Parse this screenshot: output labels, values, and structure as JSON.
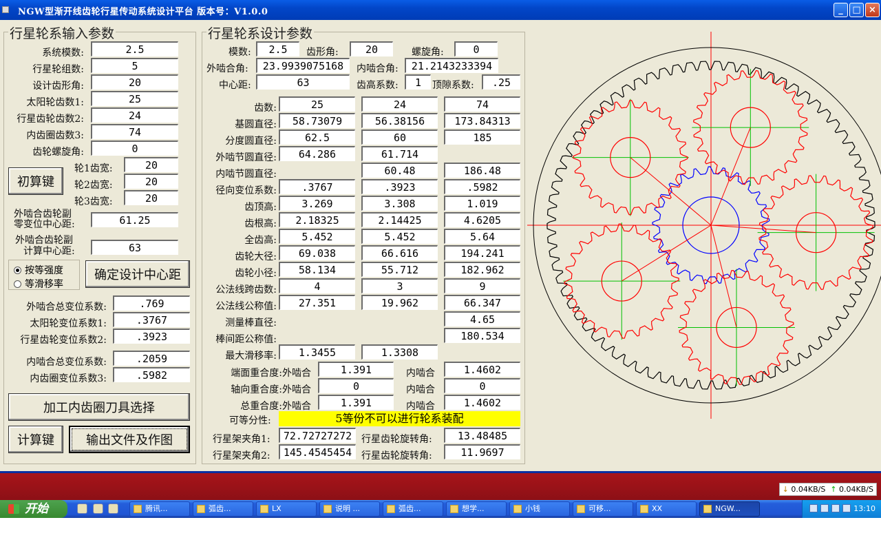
{
  "window": {
    "title": "NGW型渐开线齿轮行星传动系统设计平台   版本号：V1.0.0",
    "minimize": "_",
    "maximize": "□",
    "close": "×"
  },
  "input_panel": {
    "title": "行星轮系输入参数",
    "fields": [
      {
        "label": "系统模数:",
        "value": "2.5"
      },
      {
        "label": "行星轮组数:",
        "value": "5"
      },
      {
        "label": "设计齿形角:",
        "value": "20"
      },
      {
        "label": "太阳轮齿数1:",
        "value": "25"
      },
      {
        "label": "行星齿轮齿数2:",
        "value": "24"
      },
      {
        "label": "内齿圈齿数3:",
        "value": "74"
      },
      {
        "label": "齿轮螺旋角:",
        "value": "0"
      }
    ],
    "init_button": "初算键",
    "widths": [
      {
        "label": "轮1齿宽:",
        "value": "20"
      },
      {
        "label": "轮2齿宽:",
        "value": "20"
      },
      {
        "label": "轮3齿宽:",
        "value": "20"
      }
    ],
    "ext_zero_label1": "外啮合齿轮副",
    "ext_zero_label2": "零变位中心距:",
    "ext_zero_value": "61.25",
    "ext_calc_label1": "外啮合齿轮副",
    "ext_calc_label2": "计算中心距:",
    "ext_calc_value": "63",
    "radio_strength": "按等强度",
    "radio_slip": "等滑移率",
    "confirm_button": "确定设计中心距",
    "shift_fields": [
      {
        "label": "外啮合总变位系数:",
        "value": ".769"
      },
      {
        "label": "太阳轮变位系数1:",
        "value": ".3767"
      },
      {
        "label": "行星齿轮变位系数2:",
        "value": ".3923"
      },
      {
        "label": "内啮合总变位系数:",
        "value": ".2059"
      },
      {
        "label": "内齿圈变位系数3:",
        "value": ".5982"
      }
    ],
    "tool_button": "加工内齿圈刀具选择",
    "calc_button": "计算键",
    "output_button": "输出文件及作图"
  },
  "design_panel": {
    "title": "行星轮系设计参数",
    "module_label": "模数:",
    "module": "2.5",
    "pressure_label": "齿形角:",
    "pressure": "20",
    "helix_label": "螺旋角:",
    "helix": "0",
    "ext_angle_label": "外啮合角:",
    "ext_angle": "23.9939075168",
    "int_angle_label": "内啮合角:",
    "int_angle": "21.2143233394",
    "center_label": "中心距:",
    "center": "63",
    "addendum_coef_label": "齿高系数:",
    "addendum_coef": "1",
    "clearance_label": "顶隙系数:",
    "clearance": ".25",
    "rows": [
      {
        "label": "齿数:",
        "v1": "25",
        "v2": "24",
        "v3": "74"
      },
      {
        "label": "基圆直径:",
        "v1": "58.73079",
        "v2": "56.38156",
        "v3": "173.84313"
      },
      {
        "label": "分度圆直径:",
        "v1": "62.5",
        "v2": "60",
        "v3": "185"
      },
      {
        "label": "外啮节圆直径:",
        "v1": "64.286",
        "v2": "61.714",
        "v3": ""
      },
      {
        "label": "内啮节圆直径:",
        "v1": "",
        "v2": "60.48",
        "v3": "186.48"
      },
      {
        "label": "径向变位系数:",
        "v1": ".3767",
        "v2": ".3923",
        "v3": ".5982"
      },
      {
        "label": "齿顶高:",
        "v1": "3.269",
        "v2": "3.308",
        "v3": "1.019"
      },
      {
        "label": "齿根高:",
        "v1": "2.18325",
        "v2": "2.14425",
        "v3": "4.6205"
      },
      {
        "label": "全齿高:",
        "v1": "5.452",
        "v2": "5.452",
        "v3": "5.64"
      },
      {
        "label": "齿轮大径:",
        "v1": "69.038",
        "v2": "66.616",
        "v3": "194.241"
      },
      {
        "label": "齿轮小径:",
        "v1": "58.134",
        "v2": "55.712",
        "v3": "182.962"
      },
      {
        "label": "公法线跨齿数:",
        "v1": "4",
        "v2": "3",
        "v3": "9"
      },
      {
        "label": "公法线公称值:",
        "v1": "27.351",
        "v2": "19.962",
        "v3": "66.347"
      },
      {
        "label": "测量棒直径:",
        "v1": "",
        "v2": "",
        "v3": "4.65"
      },
      {
        "label": "棒间距公称值:",
        "v1": "",
        "v2": "",
        "v3": "180.534"
      },
      {
        "label": "最大滑移率:",
        "v1": "1.3455",
        "v2": "1.3308",
        "v3": ""
      }
    ],
    "contact": [
      {
        "label": "端面重合度:外啮合",
        "ext": "1.391",
        "int_label": "内啮合",
        "int": "1.4602"
      },
      {
        "label": "轴向重合度:外啮合",
        "ext": "0",
        "int_label": "内啮合",
        "int": "0"
      },
      {
        "label": "总重合度:外啮合",
        "ext": "1.391",
        "int_label": "内啮合",
        "int": "1.4602"
      }
    ],
    "divisible_label": "可等分性:",
    "divisible_value": "5等份不可以进行轮系装配",
    "carrier1_label": "行星架夹角1:",
    "carrier1": "72.72727272",
    "rot1_label": "行星齿轮旋转角:",
    "rot1": "13.48485",
    "carrier2_label": "行星架夹角2:",
    "carrier2": "145.4545454",
    "rot2_label": "行星齿轮旋转角:",
    "rot2": "11.9697"
  },
  "drawing": {
    "sun_teeth": 25,
    "planet_teeth": 24,
    "ring_teeth": 74,
    "planets": 5,
    "sun_color": "#0000ff",
    "planet_color": "#ff0000",
    "ring_color": "#000000",
    "axis_color": "#ff0000",
    "planet_axis_color": "#00c000"
  },
  "taskbar": {
    "start": "开始",
    "items": [
      "腾讯...",
      "弧齿...",
      "LX",
      "说明 ...",
      "弧齿...",
      "想学...",
      "小钱",
      "可移...",
      "XX",
      "NGW..."
    ],
    "net_down": "0.04KB/S",
    "net_up": "0.04KB/S",
    "time": "13:10"
  }
}
